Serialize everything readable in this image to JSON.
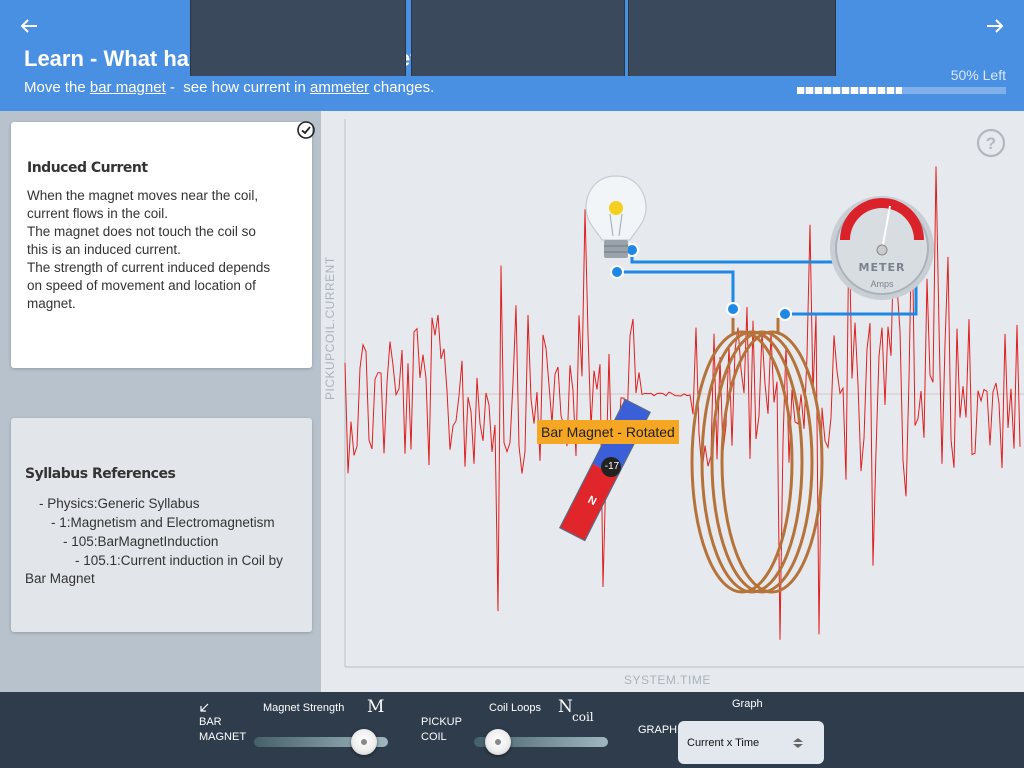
{
  "header": {
    "title_prefix": "Learn",
    "title_sep": " - ",
    "title_main": "What happens when a Magnet moves near a Coil?",
    "subtitle_pre": "Move the ",
    "subtitle_link1": "bar magnet",
    "subtitle_mid": " -  see how current in ",
    "subtitle_link2": "ammeter",
    "subtitle_post": " changes.",
    "progress_label": "50% Left",
    "progress_fraction": 0.5
  },
  "info_card": {
    "heading": "Induced Current",
    "lines": [
      "When the magnet moves near the coil,",
      "current flows in the coil.",
      "The magnet does not touch the coil so",
      "this is an induced current.",
      "The strength of current induced depends",
      "on speed of movement and location of",
      "magnet."
    ]
  },
  "syllabus": {
    "heading": "Syllabus References",
    "lines": [
      "- Physics:Generic Syllabus",
      "- 1:Magnetism and Electromagnetism",
      "- 105:BarMagnetInduction",
      "- 105.1:Current induction in Coil by",
      "Bar Magnet"
    ]
  },
  "graph": {
    "y_label": "PICKUPCOIL.CURRENT",
    "x_label": "SYSTEM.TIME"
  },
  "scene": {
    "magnet_label": "Bar Magnet  - Rotated",
    "magnet_value": "-17",
    "magnet_pole": "N",
    "meter_title": "METER",
    "meter_unit": "Amps"
  },
  "footer": {
    "bar_magnet_label_1": "BAR",
    "bar_magnet_label_2": "MAGNET",
    "magnet_strength_label": "Magnet Strength",
    "magnet_strength_symbol": "M",
    "magnet_strength_value": 0.9,
    "pickup_coil_label_1": "PICKUP",
    "pickup_coil_label_2": "COIL",
    "coil_loops_label": "Coil Loops",
    "coil_loops_symbol": "N",
    "coil_loops_subscript": "coil",
    "coil_loops_value": 0.1,
    "graph_title": "Graph",
    "graph_label": "GRAPH",
    "graph_selected": "Current x Time"
  },
  "colors": {
    "header_bg": "#4a90e2",
    "signal": "#e02020",
    "wire": "#1e88e5",
    "magnet_label_bg": "#f5a623"
  }
}
